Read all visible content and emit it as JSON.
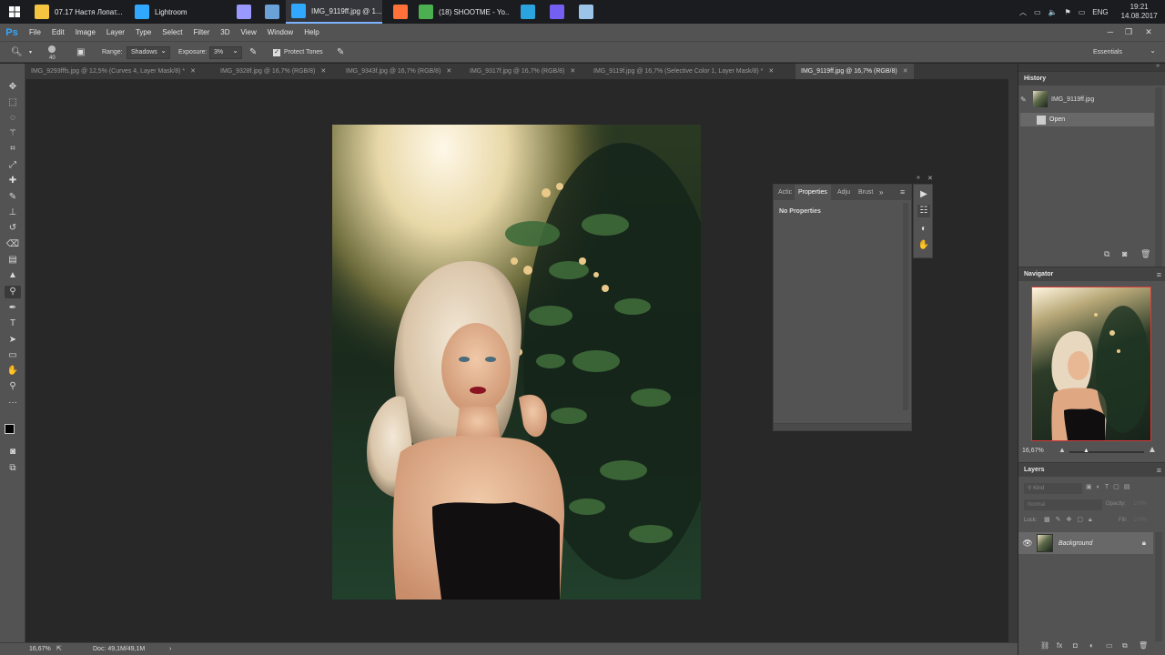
{
  "taskbar": {
    "items": [
      {
        "label": "07.17 Настя Лопат...",
        "icon": "folder-icon",
        "color": "#f5c542"
      },
      {
        "label": "Lightroom",
        "icon": "lightroom-icon",
        "color": "#31a8ff"
      },
      {
        "label": "",
        "icon": "premiere-icon",
        "color": "#9999ff"
      },
      {
        "label": "",
        "icon": "photos-icon",
        "color": "#6aa2d8"
      },
      {
        "label": "IMG_9119ff.jpg @ 1...",
        "icon": "photoshop-icon",
        "color": "#31a8ff",
        "active": true
      },
      {
        "label": "",
        "icon": "firefox-icon",
        "color": "#ff7139"
      },
      {
        "label": "(18) SHOOTME - Yo...",
        "icon": "chrome-icon",
        "color": "#4caf50"
      },
      {
        "label": "",
        "icon": "telegram-icon",
        "color": "#2aa3df"
      },
      {
        "label": "",
        "icon": "viber-icon",
        "color": "#7360f2"
      },
      {
        "label": "",
        "icon": "notepad-icon",
        "color": "#9bc4e8"
      }
    ],
    "lang": "ENG",
    "time": "19:21",
    "date": "14.08.2017"
  },
  "app": {
    "logo": "Ps",
    "brand_color": "#31a8ff"
  },
  "menu": [
    "File",
    "Edit",
    "Image",
    "Layer",
    "Type",
    "Select",
    "Filter",
    "3D",
    "View",
    "Window",
    "Help"
  ],
  "options": {
    "brush_size": "40",
    "range_label": "Range:",
    "range_value": "Shadows",
    "exposure_label": "Exposure:",
    "exposure_value": "3%",
    "protect_tones_label": "Protect Tones",
    "protect_tones_checked": true,
    "workspace": "Essentials"
  },
  "tabs": [
    {
      "label": "IMG_9293fffs.jpg @ 12,5% (Curves 4, Layer Mask/8) *"
    },
    {
      "label": "IMG_9328f.jpg @ 16,7% (RGB/8)"
    },
    {
      "label": "IMG_9343f.jpg @ 16,7% (RGB/8)"
    },
    {
      "label": "IMG_9317f.jpg @ 16,7% (RGB/8)"
    },
    {
      "label": "IMG_9119f.jpg @ 16,7% (Selective Color 1, Layer Mask/8) *"
    },
    {
      "label": "IMG_9119ff.jpg @ 16,7% (RGB/8)",
      "active": true
    }
  ],
  "tools": [
    "move-tool-icon",
    "marquee-tool-icon",
    "lasso-tool-icon",
    "magic-wand-icon",
    "crop-tool-icon",
    "eyedropper-icon",
    "healing-brush-icon",
    "brush-tool-icon",
    "clone-stamp-icon",
    "history-brush-icon",
    "eraser-icon",
    "gradient-tool-icon",
    "sharpen-tool-icon",
    "dodge-tool-icon",
    "pen-tool-icon",
    "type-tool-icon",
    "path-selection-icon",
    "rectangle-tool-icon",
    "hand-tool-icon",
    "zoom-tool-icon",
    "more-tools-icon",
    "color-swatches-icon",
    "quick-mask-icon",
    "screen-mode-icon"
  ],
  "properties": {
    "tabs": [
      "Actic",
      "Properties",
      "Adju",
      "Brust"
    ],
    "body": "No Properties"
  },
  "history": {
    "title": "History",
    "snapshot": "IMG_9119ff.jpg",
    "states": [
      "Open"
    ]
  },
  "navigator": {
    "title": "Navigator",
    "zoom": "16,67%",
    "zoom_fraction": 0.22,
    "frame_color": "#d43a3a"
  },
  "layers": {
    "title": "Layers",
    "kind_placeholder": "Kind",
    "blend_mode": "Normal",
    "opacity_label": "Opacity:",
    "opacity_value": "100%",
    "lock_label": "Lock:",
    "fill_label": "Fill:",
    "fill_value": "100%",
    "items": [
      {
        "name": "Background",
        "visible": true,
        "locked": true
      }
    ]
  },
  "status": {
    "zoom": "16,67%",
    "doc": "Doc: 49,1M/49,1M"
  }
}
